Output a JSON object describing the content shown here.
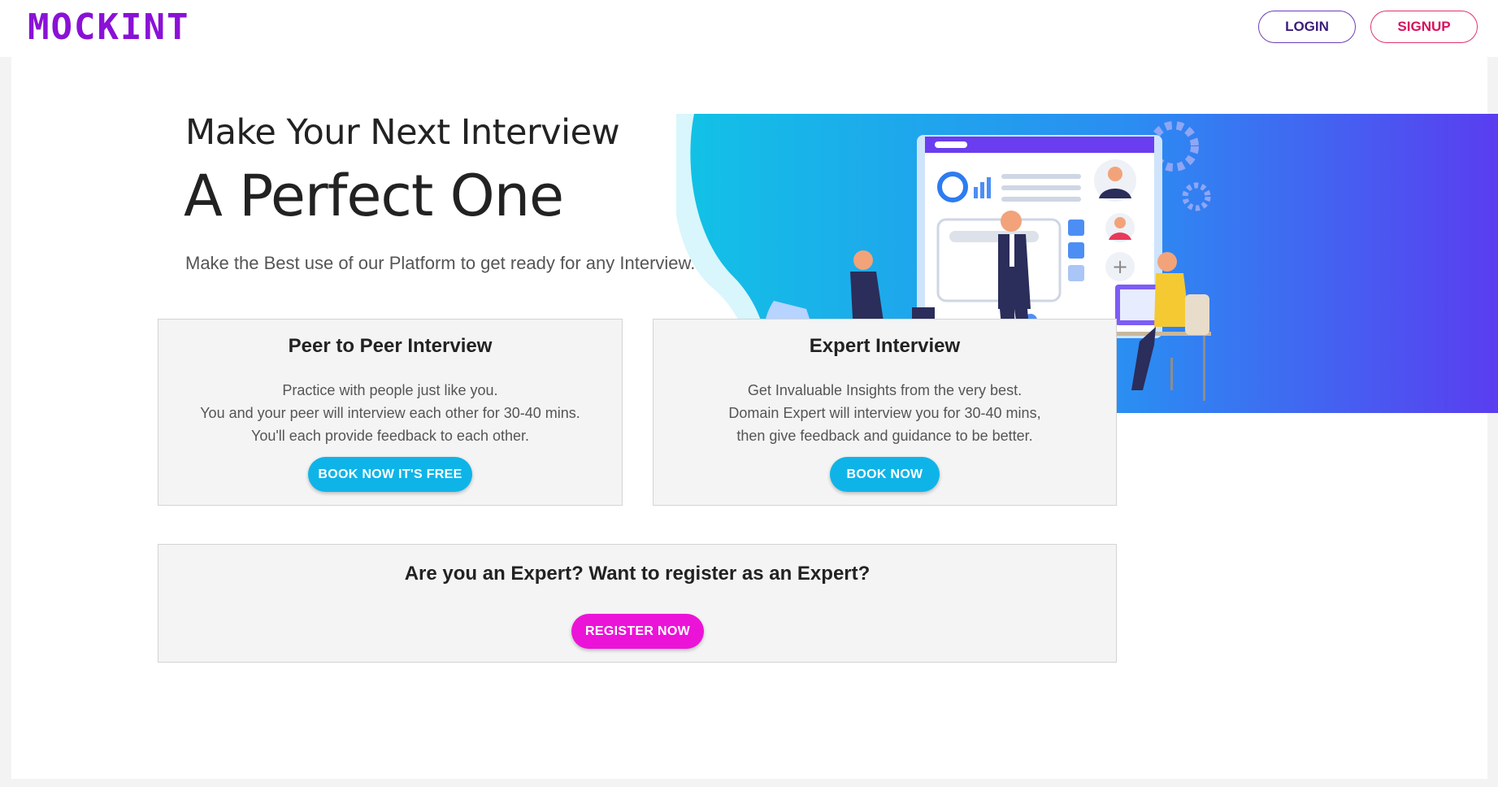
{
  "brand": {
    "logo_text": "MOCKINT",
    "logo_color": "#8a11d6"
  },
  "nav": {
    "login_label": "LOGIN",
    "signup_label": "SIGNUP"
  },
  "hero": {
    "heading_line1": "Make Your Next Interview",
    "heading_line2": "A Perfect One",
    "subtitle": "Make the Best use of our Platform to get ready for any Interview.",
    "illustration_icon": "interview-illustration"
  },
  "cards": [
    {
      "title": "Peer to Peer Interview",
      "lines": [
        "Practice with people just like you.",
        "You and your peer will interview each other for 30-40 mins.",
        "You'll each provide feedback to each other."
      ],
      "button_label": "BOOK NOW IT'S FREE"
    },
    {
      "title": "Expert Interview",
      "lines": [
        "Get Invaluable Insights from the very best.",
        "Domain Expert will interview you for 30-40 mins,",
        "then give feedback and guidance to be better."
      ],
      "button_label": "BOOK NOW"
    }
  ],
  "expert_register": {
    "question": "Are you an Expert? Want to register as an Expert?",
    "button_label": "REGISTER NOW"
  },
  "colors": {
    "accent_blue": "#0eb4e8",
    "accent_pink": "#ec13d8",
    "login_border": "#6a3fb8",
    "signup_border": "#e0336b"
  }
}
